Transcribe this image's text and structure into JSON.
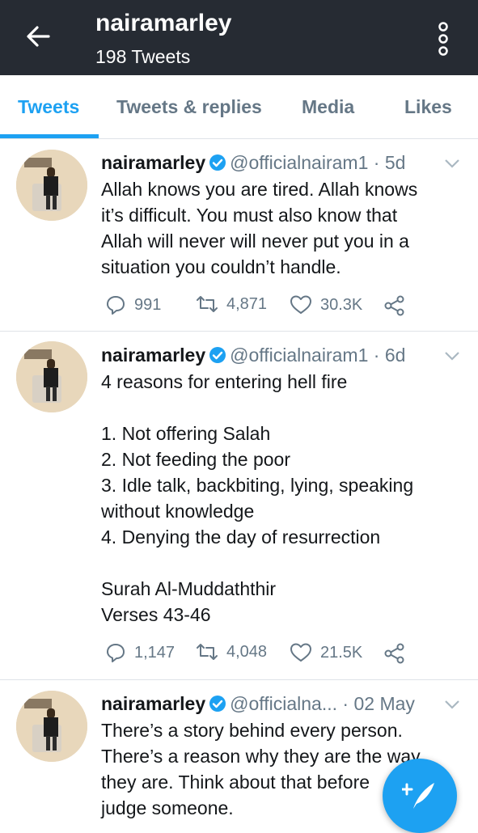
{
  "header": {
    "title": "nairamarley",
    "subtitle": "198 Tweets"
  },
  "tabs": [
    "Tweets",
    "Tweets & replies",
    "Media",
    "Likes"
  ],
  "colors": {
    "accent": "#1da1f2",
    "topbar": "#262b33",
    "muted": "#657786"
  },
  "tweets": [
    {
      "name": "nairamarley",
      "handle": "@officialnairam1",
      "time": "· 5d",
      "lines": [
        "Allah knows you are tired. Allah knows",
        "it’s difficult. You must also know that",
        "Allah will never will never put you in a",
        "situation you couldn’t handle."
      ],
      "replies": "991",
      "retweets": "4,871",
      "likes": "30.3K"
    },
    {
      "name": "nairamarley",
      "handle": "@officialnairam1",
      "time": "· 6d",
      "lines": [
        "4 reasons for entering hell fire",
        "",
        "1.  Not offering Salah",
        "2. Not feeding the poor",
        "3. Idle talk, backbiting, lying, speaking",
        "without knowledge",
        "4. Denying the day of resurrection",
        "",
        "Surah Al-Muddaththir",
        "Verses 43-46"
      ],
      "replies": "1,147",
      "retweets": "4,048",
      "likes": "21.5K"
    },
    {
      "name": "nairamarley",
      "handle": "@officialna...",
      "time": "· 02 May",
      "lines": [
        "There’s a story behind every person.",
        "There’s a reason why they are the way",
        "they are. Think about that before",
        "judge someone."
      ]
    }
  ],
  "icons": [
    "back-arrow-icon",
    "more-options-icon",
    "verified-badge-icon",
    "chevron-down-icon",
    "reply-icon",
    "retweet-icon",
    "like-icon",
    "share-icon",
    "compose-tweet-icon"
  ]
}
